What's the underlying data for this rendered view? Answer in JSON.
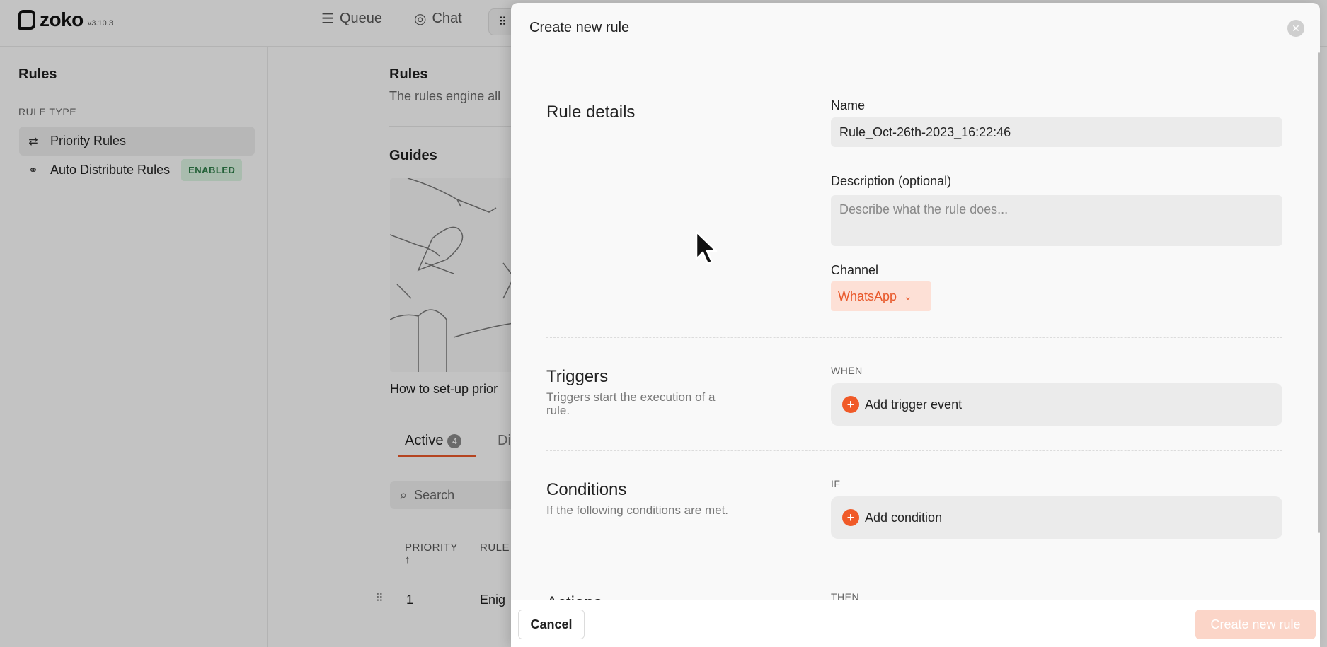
{
  "app": {
    "logo_text": "zoko",
    "version": "v3.10.3"
  },
  "topnav": {
    "queue": "Queue",
    "chat": "Chat"
  },
  "sidebar": {
    "title": "Rules",
    "section_label": "RULE TYPE",
    "items": [
      {
        "label": "Priority Rules",
        "icon": "priority-rules-icon"
      },
      {
        "label": "Auto Distribute Rules",
        "icon": "distribute-icon",
        "badge": "ENABLED"
      }
    ]
  },
  "main": {
    "title": "Rules",
    "subtitle": "The rules engine all",
    "guides_title": "Guides",
    "guide_caption": "How to set-up prior",
    "tabs": {
      "active_label": "Active",
      "active_count": "4",
      "other_label": "Di"
    },
    "search_placeholder": "Search",
    "table": {
      "col_priority": "PRIORITY ↑",
      "col_rule": "RULE",
      "rows": [
        {
          "priority": "1",
          "name": "Enig"
        }
      ]
    }
  },
  "modal": {
    "title": "Create new rule",
    "rule_details": {
      "title": "Rule details",
      "name_label": "Name",
      "name_value": "Rule_Oct-26th-2023_16:22:46",
      "description_label": "Description (optional)",
      "description_placeholder": "Describe what the rule does...",
      "channel_label": "Channel",
      "channel_value": "WhatsApp"
    },
    "triggers": {
      "title": "Triggers",
      "desc": "Triggers start the execution of a rule.",
      "keyword": "WHEN",
      "add_label": "Add trigger event"
    },
    "conditions": {
      "title": "Conditions",
      "desc": "If the following conditions are met.",
      "keyword": "IF",
      "add_label": "Add condition"
    },
    "actions": {
      "title": "Actions",
      "keyword": "THEN"
    },
    "footer": {
      "cancel_label": "Cancel",
      "create_label": "Create new rule"
    }
  },
  "colors": {
    "accent": "#f05a28",
    "enabled_badge": "#2e7d48",
    "channel_bg": "#fde0d6"
  }
}
